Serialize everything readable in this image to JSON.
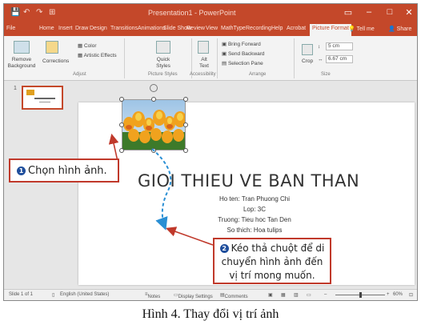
{
  "window": {
    "title": "Presentation1 - PowerPoint",
    "controls": [
      "▭",
      "–",
      "□",
      "✕"
    ]
  },
  "quick_access": [
    "💾",
    "↶",
    "↷",
    "⊞"
  ],
  "tabs": [
    "File",
    "Home",
    "Insert",
    "Draw",
    "Design",
    "Transitions",
    "Animations",
    "Slide Show",
    "Review",
    "View",
    "MathType",
    "Recording",
    "Help",
    "Acrobat",
    "Picture Format"
  ],
  "active_tab": "Picture Format",
  "tell_me": "Tell me",
  "share": "Share",
  "ribbon": {
    "remove_background": "Remove Background",
    "corrections": "Corrections",
    "color": "Color",
    "artistic_effects": "Artistic Effects",
    "quick_styles": "Quick Styles",
    "alt_text": "Alt Text",
    "bring_forward": "Bring Forward",
    "send_backward": "Send Backward",
    "selection_pane": "Selection Pane",
    "crop": "Crop",
    "height": "5 cm",
    "width": "6.67 cm",
    "groups": [
      "Adjust",
      "Picture Styles",
      "Accessibility",
      "Arrange",
      "Size"
    ]
  },
  "thumbnail_number": "1",
  "slide": {
    "title": "GIOI THIEU VE BAN THAN",
    "lines": [
      "Ho ten: Tran Phuong Chi",
      "Lop: 3C",
      "Truong: Tieu hoc Tan Den",
      "So thich: Hoa tulips"
    ]
  },
  "status": {
    "slide_of": "Slide 1 of 1",
    "language": "English (United States)",
    "notes": "Notes",
    "display_settings": "Display Settings",
    "comments": "Comments",
    "zoom": "60%"
  },
  "callouts": {
    "step1_number": "1",
    "step1_text": "Chọn hình ảnh.",
    "step2_number": "2",
    "step2_text": "Kéo thả chuột để di chuyển hình ảnh đến vị trí mong muốn."
  },
  "caption": "Hình 4. Thay đổi vị trí ảnh",
  "colors": {
    "accent": "#c4482a",
    "callout_border": "#c0392b",
    "badge": "#1f4e9c",
    "drag_arrow": "#2a8fd4"
  }
}
